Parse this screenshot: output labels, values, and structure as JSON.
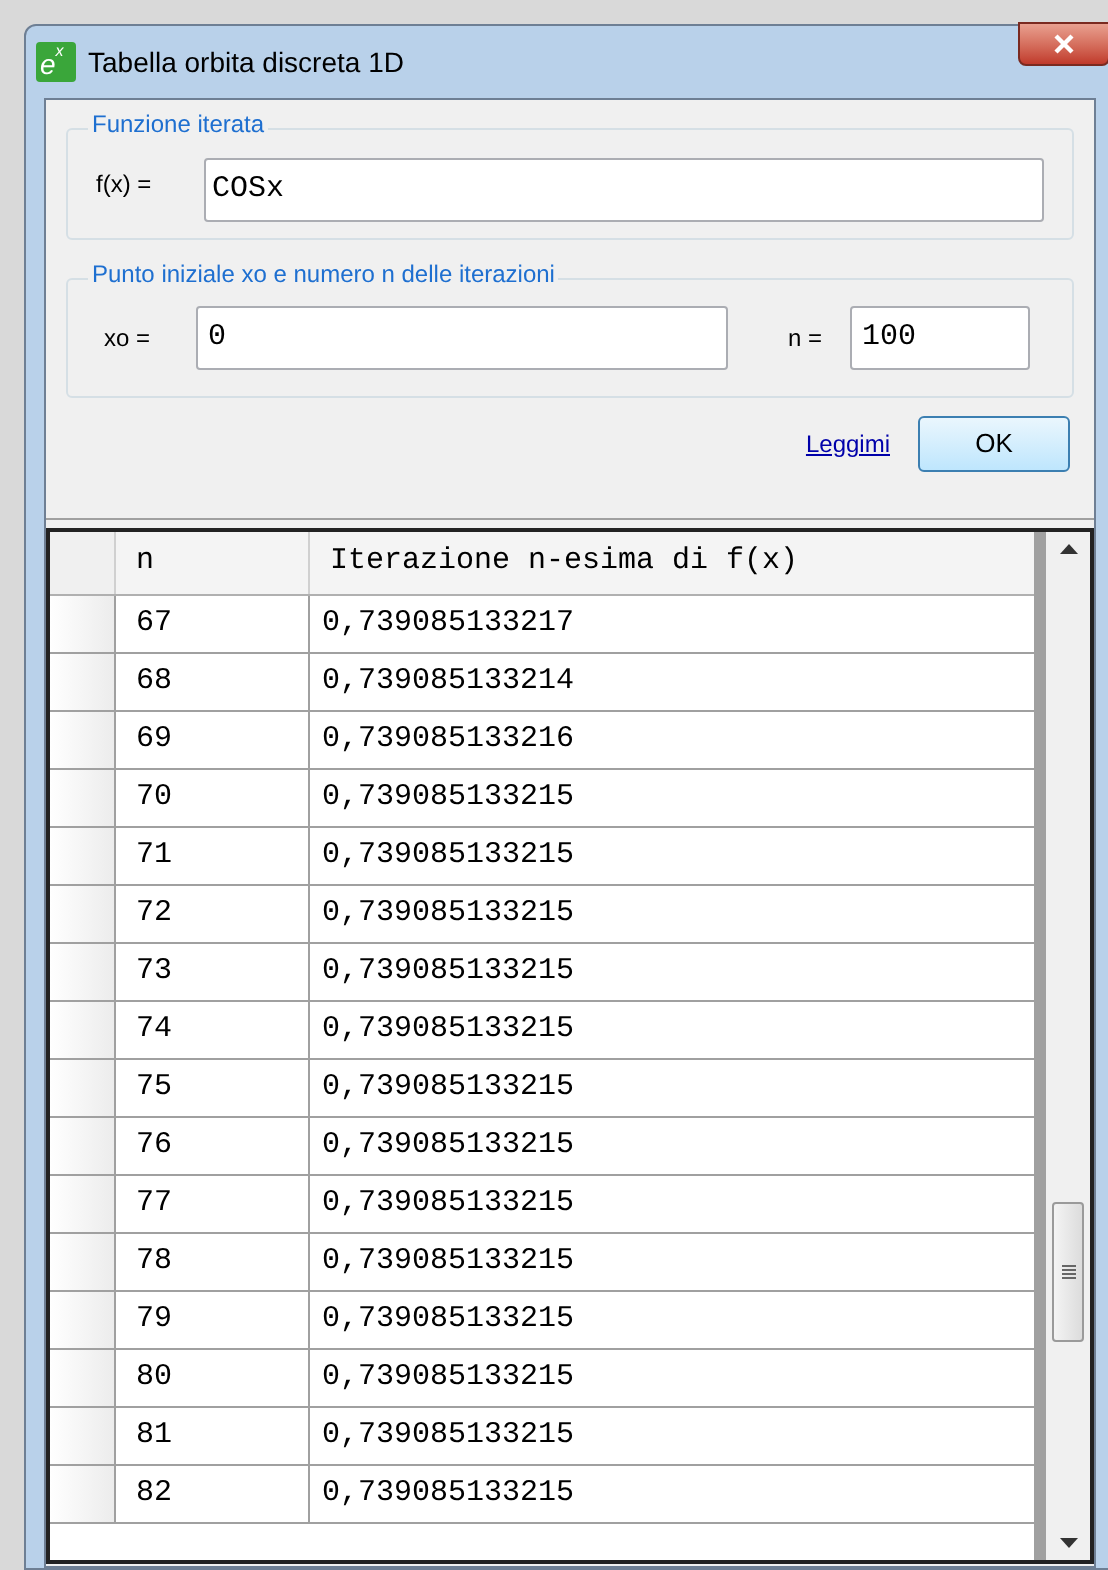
{
  "window": {
    "title": "Tabella orbita discreta 1D",
    "logo_base": "e",
    "logo_exponent": "x"
  },
  "function_group": {
    "legend": "Funzione iterata",
    "label": "f(x) =",
    "value": "COSx"
  },
  "start_group": {
    "legend": "Punto iniziale xo e numero n delle iterazioni",
    "x0_label": "xo =",
    "x0_value": "0",
    "n_label": "n =",
    "n_value": "100"
  },
  "readme_link": "Leggimi",
  "ok_button": "OK",
  "table": {
    "columns": [
      "n",
      "Iterazione n-esima di f(x)"
    ],
    "rows": [
      [
        "67",
        "0,739085133217"
      ],
      [
        "68",
        "0,739085133214"
      ],
      [
        "69",
        "0,739085133216"
      ],
      [
        "70",
        "0,739085133215"
      ],
      [
        "71",
        "0,739085133215"
      ],
      [
        "72",
        "0,739085133215"
      ],
      [
        "73",
        "0,739085133215"
      ],
      [
        "74",
        "0,739085133215"
      ],
      [
        "75",
        "0,739085133215"
      ],
      [
        "76",
        "0,739085133215"
      ],
      [
        "77",
        "0,739085133215"
      ],
      [
        "78",
        "0,739085133215"
      ],
      [
        "79",
        "0,739085133215"
      ],
      [
        "80",
        "0,739085133215"
      ],
      [
        "81",
        "0,739085133215"
      ],
      [
        "82",
        "0,739085133215"
      ]
    ]
  }
}
